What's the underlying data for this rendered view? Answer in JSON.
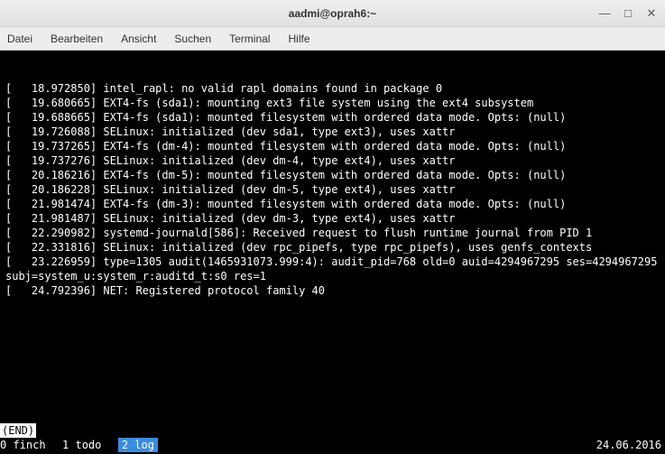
{
  "window": {
    "title": "aadmi@oprah6:~",
    "controls": {
      "min": "—",
      "max": "□",
      "close": "✕"
    }
  },
  "menu": {
    "file": "Datei",
    "edit": "Bearbeiten",
    "view": "Ansicht",
    "search": "Suchen",
    "terminal": "Terminal",
    "help": "Hilfe"
  },
  "terminal": {
    "lines": [
      "[   18.972850] intel_rapl: no valid rapl domains found in package 0",
      "[   19.680665] EXT4-fs (sda1): mounting ext3 file system using the ext4 subsystem",
      "[   19.688665] EXT4-fs (sda1): mounted filesystem with ordered data mode. Opts: (null)",
      "[   19.726088] SELinux: initialized (dev sda1, type ext3), uses xattr",
      "[   19.737265] EXT4-fs (dm-4): mounted filesystem with ordered data mode. Opts: (null)",
      "[   19.737276] SELinux: initialized (dev dm-4, type ext4), uses xattr",
      "[   20.186216] EXT4-fs (dm-5): mounted filesystem with ordered data mode. Opts: (null)",
      "[   20.186228] SELinux: initialized (dev dm-5, type ext4), uses xattr",
      "[   21.981474] EXT4-fs (dm-3): mounted filesystem with ordered data mode. Opts: (null)",
      "[   21.981487] SELinux: initialized (dev dm-3, type ext4), uses xattr",
      "[   22.290982] systemd-journald[586]: Received request to flush runtime journal from PID 1",
      "[   22.331816] SELinux: initialized (dev rpc_pipefs, type rpc_pipefs), uses genfs_contexts",
      "[   23.226959] type=1305 audit(1465931073.999:4): audit_pid=768 old=0 auid=4294967295 ses=4294967295 subj=system_u:system_r:auditd_t:s0 res=1",
      "[   24.792396] NET: Registered protocol family 40"
    ],
    "pager_status": "(END)",
    "tabs": [
      {
        "index": "0",
        "name": "finch"
      },
      {
        "index": "1",
        "name": "todo"
      },
      {
        "index": "2",
        "name": "log"
      }
    ],
    "active_tab": 2,
    "date": "24.06.2016"
  }
}
